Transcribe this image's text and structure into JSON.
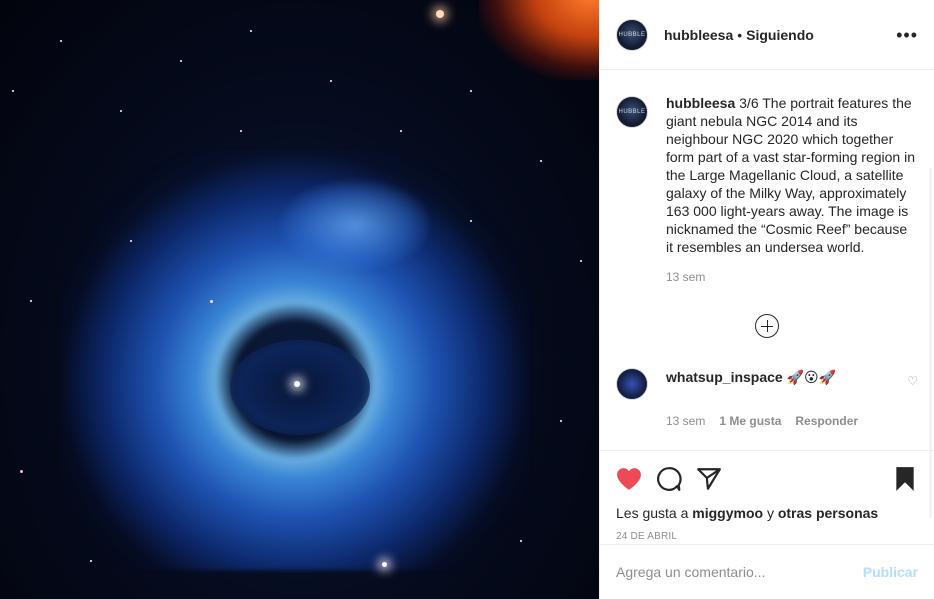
{
  "post": {
    "image_alt": "Nebula NGC 2014 and NGC 2020",
    "author": "hubbleesa",
    "avatar_text": "HUBBLE",
    "follow_status": "Siguiendo",
    "more_label": "•••"
  },
  "caption": {
    "author": "hubbleesa",
    "text": "3/6 The portrait features the giant nebula NGC 2014 and its neighbour NGC 2020 which together form part of a vast star-forming region in the Large Magellanic Cloud, a satellite galaxy of the Milky Way, approximately 163 000 light-years away. The image is nicknamed the “Cosmic Reef” because it resembles an undersea world.",
    "time": "13 sem"
  },
  "comments": [
    {
      "author": "whatsup_inspace",
      "text": "🚀😮🚀",
      "time": "13 sem",
      "likes": "1 Me gusta",
      "reply": "Responder"
    }
  ],
  "actions": {
    "like_icon": "heart-filled-icon",
    "comment_icon": "comment-icon",
    "share_icon": "paper-plane-icon",
    "save_icon": "bookmark-filled-icon",
    "like_color": "#ed4956"
  },
  "likes": {
    "prefix": "Les gusta a",
    "user": "miggymoo",
    "connector": "y",
    "others": "otras personas"
  },
  "date": "24 DE ABRIL",
  "add_comment": {
    "placeholder": "Agrega un comentario...",
    "publish_label": "Publicar"
  }
}
